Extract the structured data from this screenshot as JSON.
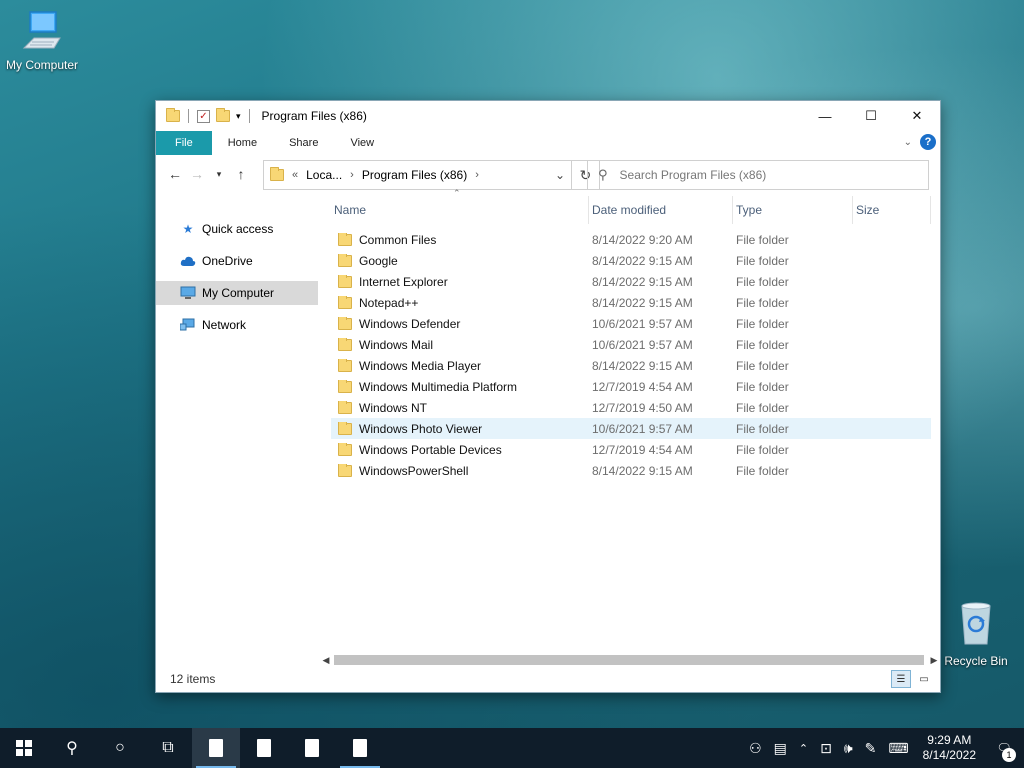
{
  "desktop": {
    "icons": [
      {
        "label": "My Computer"
      },
      {
        "label": "Recycle Bin"
      }
    ]
  },
  "window": {
    "title": "Program Files (x86)",
    "controls": {
      "minimize": "—",
      "maximize": "☐",
      "close": "✕"
    },
    "ribbon_tabs": [
      "File",
      "Home",
      "Share",
      "View"
    ],
    "address": {
      "overflow": "«",
      "crumbs": [
        "Loca...",
        "Program Files (x86)"
      ]
    },
    "search_placeholder": "Search Program Files (x86)",
    "nav_pane": [
      {
        "label": "Quick access",
        "icon": "star-icon"
      },
      {
        "label": "OneDrive",
        "icon": "cloud-icon"
      },
      {
        "label": "My Computer",
        "icon": "computer-icon",
        "selected": true
      },
      {
        "label": "Network",
        "icon": "network-icon"
      }
    ],
    "columns": [
      "Name",
      "Date modified",
      "Type",
      "Size"
    ],
    "files": [
      {
        "name": "Common Files",
        "date": "8/14/2022 9:20 AM",
        "type": "File folder"
      },
      {
        "name": "Google",
        "date": "8/14/2022 9:15 AM",
        "type": "File folder"
      },
      {
        "name": "Internet Explorer",
        "date": "8/14/2022 9:15 AM",
        "type": "File folder"
      },
      {
        "name": "Notepad++",
        "date": "8/14/2022 9:15 AM",
        "type": "File folder"
      },
      {
        "name": "Windows Defender",
        "date": "10/6/2021 9:57 AM",
        "type": "File folder"
      },
      {
        "name": "Windows Mail",
        "date": "10/6/2021 9:57 AM",
        "type": "File folder"
      },
      {
        "name": "Windows Media Player",
        "date": "8/14/2022 9:15 AM",
        "type": "File folder"
      },
      {
        "name": "Windows Multimedia Platform",
        "date": "12/7/2019 4:54 AM",
        "type": "File folder"
      },
      {
        "name": "Windows NT",
        "date": "12/7/2019 4:50 AM",
        "type": "File folder"
      },
      {
        "name": "Windows Photo Viewer",
        "date": "10/6/2021 9:57 AM",
        "type": "File folder",
        "hover": true
      },
      {
        "name": "Windows Portable Devices",
        "date": "12/7/2019 4:54 AM",
        "type": "File folder"
      },
      {
        "name": "WindowsPowerShell",
        "date": "8/14/2022 9:15 AM",
        "type": "File folder"
      }
    ],
    "status": "12 items"
  },
  "taskbar": {
    "time": "9:29 AM",
    "date": "8/14/2022",
    "notification_count": "1"
  },
  "colors": {
    "accent": "#1b9aaa",
    "folder": "#f8d775",
    "taskbar": "#0f1d2a",
    "selection": "#d9d9d9",
    "hover": "#e5f3fb"
  }
}
